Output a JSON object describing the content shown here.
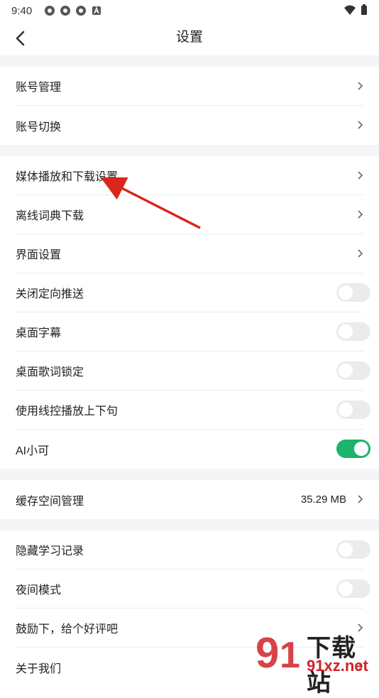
{
  "status_bar": {
    "time": "9:40"
  },
  "header": {
    "title": "设置"
  },
  "sections": [
    {
      "rows": [
        {
          "label": "账号管理",
          "control": "chevron"
        },
        {
          "label": "账号切换",
          "control": "chevron"
        }
      ]
    },
    {
      "rows": [
        {
          "label": "媒体播放和下载设置",
          "control": "chevron"
        },
        {
          "label": "离线词典下载",
          "control": "chevron"
        },
        {
          "label": "界面设置",
          "control": "chevron"
        },
        {
          "label": "关闭定向推送",
          "control": "toggle",
          "on": false
        },
        {
          "label": "桌面字幕",
          "control": "toggle",
          "on": false
        },
        {
          "label": "桌面歌词锁定",
          "control": "toggle",
          "on": false
        },
        {
          "label": "使用线控播放上下句",
          "control": "toggle",
          "on": false
        },
        {
          "label": "AI小可",
          "control": "toggle",
          "on": true
        }
      ]
    },
    {
      "rows": [
        {
          "label": "缓存空间管理",
          "control": "chevron",
          "value": "35.29 MB"
        }
      ]
    },
    {
      "rows": [
        {
          "label": "隐藏学习记录",
          "control": "toggle",
          "on": false
        },
        {
          "label": "夜间模式",
          "control": "toggle",
          "on": false
        },
        {
          "label": "鼓励下，给个好评吧",
          "control": "chevron"
        },
        {
          "label": "关于我们",
          "control": "chevron"
        }
      ]
    }
  ],
  "watermark": {
    "brand": "下载站",
    "url": "91xz.net"
  },
  "colors": {
    "toggle_on": "#1bb46a",
    "toggle_off": "#ebebeb",
    "annotation_arrow": "#d9261c",
    "section_gap": "#f4f5f7"
  }
}
